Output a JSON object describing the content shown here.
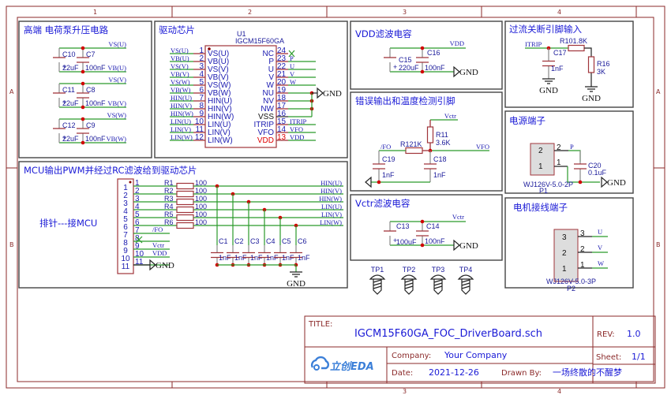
{
  "frame": {
    "columns": [
      "1",
      "2",
      "3",
      "4"
    ],
    "rows": [
      "A",
      "B"
    ]
  },
  "colors": {
    "net": "#2a9a2a",
    "component": "#a0343a",
    "junction": "#d00000",
    "text": "#1a1ad6"
  },
  "high_side": {
    "title": "高端 电荷泵升压电路",
    "groups": [
      {
        "cap_e": "C10",
        "cap_e_value": "22uF",
        "cap": "C7",
        "cap_value": "100nF",
        "net_top": "VS(U)",
        "net_bottom": "VB(U)"
      },
      {
        "cap_e": "C11",
        "cap_e_value": "22uF",
        "cap": "C8",
        "cap_value": "100nF",
        "net_top": "VS(V)",
        "net_bottom": "VB(V)"
      },
      {
        "cap_e": "C12",
        "cap_e_value": "22uF",
        "cap": "C9",
        "cap_value": "100nF",
        "net_top": "VS(W)",
        "net_bottom": "VB(W)"
      }
    ]
  },
  "driver": {
    "title": "驱动芯片",
    "designator": "U1",
    "part": "IGCM15F60GA",
    "left_pins": [
      {
        "num": "1",
        "name": "VS(U)",
        "net": "VS(U)"
      },
      {
        "num": "2",
        "name": "VB(U)",
        "net": "VB(U)"
      },
      {
        "num": "3",
        "name": "VS(V)",
        "net": "VS(V)"
      },
      {
        "num": "4",
        "name": "VB(V)",
        "net": "VB(V)"
      },
      {
        "num": "5",
        "name": "VS(W)",
        "net": "VS(W)"
      },
      {
        "num": "6",
        "name": "VB(W)",
        "net": "VB(W)"
      },
      {
        "num": "7",
        "name": "HIN(U)",
        "net": "HIN(U)"
      },
      {
        "num": "8",
        "name": "HIN(V)",
        "net": "HIN(V)"
      },
      {
        "num": "9",
        "name": "HIN(W)",
        "net": "HIN(W)"
      },
      {
        "num": "10",
        "name": "LIN(U)",
        "net": "LIN(U)"
      },
      {
        "num": "11",
        "name": "LIN(V)",
        "net": "LIN(V)"
      },
      {
        "num": "12",
        "name": "LIN(W)",
        "net": "LIN(W)"
      }
    ],
    "right_pins": [
      {
        "num": "24",
        "name": "NC",
        "net": ""
      },
      {
        "num": "23",
        "name": "P",
        "net": "P"
      },
      {
        "num": "22",
        "name": "U",
        "net": "U"
      },
      {
        "num": "21",
        "name": "V",
        "net": "V"
      },
      {
        "num": "20",
        "name": "W",
        "net": "W"
      },
      {
        "num": "19",
        "name": "NU",
        "net": ""
      },
      {
        "num": "18",
        "name": "NV",
        "net": ""
      },
      {
        "num": "17",
        "name": "NW",
        "net": ""
      },
      {
        "num": "16",
        "name": "VSS",
        "net": ""
      },
      {
        "num": "15",
        "name": "ITRIP",
        "net": "ITRIP"
      },
      {
        "num": "14",
        "name": "VFO",
        "net": "VFO"
      },
      {
        "num": "13",
        "name": "VDD",
        "net": "VDD"
      }
    ],
    "gnd": "GND"
  },
  "mcu": {
    "title": "MCU输出PWM并经过RC滤波给到驱动芯片",
    "header_label": "排针---接MCU",
    "header_pins": [
      "1",
      "2",
      "3",
      "4",
      "5",
      "6",
      "7",
      "8",
      "9",
      "10",
      "11"
    ],
    "channels": [
      {
        "res": "R1",
        "res_value": "100",
        "cap": "C1",
        "cap_value": "1nF",
        "net": "HIN(U)"
      },
      {
        "res": "R2",
        "res_value": "100",
        "cap": "C2",
        "cap_value": "1nF",
        "net": "HIN(V)"
      },
      {
        "res": "R3",
        "res_value": "100",
        "cap": "C3",
        "cap_value": "1nF",
        "net": "HIN(W)"
      },
      {
        "res": "R4",
        "res_value": "100",
        "cap": "C4",
        "cap_value": "1nF",
        "net": "LIN(U)"
      },
      {
        "res": "R5",
        "res_value": "100",
        "cap": "C5",
        "cap_value": "1nF",
        "net": "LIN(V)"
      },
      {
        "res": "R6",
        "res_value": "100",
        "cap": "C6",
        "cap_value": "1nF",
        "net": "LIN(W)"
      }
    ],
    "pin7_net": "/FO",
    "pin9_net": "Vctr",
    "pin10_net": "VDD",
    "pin11_gnd": "GND",
    "cap_gnd": "GND"
  },
  "vdd_filter": {
    "title": "VDD滤波电容",
    "cap_e": "C15",
    "cap_e_value": "220uF",
    "cap": "C16",
    "cap_value": "100nF",
    "net": "VDD",
    "gnd": "GND"
  },
  "fault": {
    "title": "错误输出和温度检测引脚",
    "r_pullup": "R11",
    "r_pullup_value": "3.6K",
    "r_series": "R121K",
    "cap_left": "C19",
    "cap_left_value": "1nF",
    "cap_right": "C18",
    "cap_right_value": "1nF",
    "net_top": "Vctr",
    "net_left": "/FO",
    "net_right": "VFO"
  },
  "vctr_filter": {
    "title": "Vctr滤波电容",
    "cap_e": "C13",
    "cap_e_value": "100uF",
    "cap": "C14",
    "cap_value": "100nF",
    "net": "Vctr",
    "gnd": "GND"
  },
  "test_points": [
    "TP1",
    "TP2",
    "TP3",
    "TP4"
  ],
  "itrip": {
    "title": "过流关断引脚输入",
    "net": "ITRIP",
    "r_series": "R101.8K",
    "r_shunt": "R16",
    "r_shunt_value": "3K",
    "cap": "C17",
    "cap_value": "1nF",
    "gnd": "GND"
  },
  "power": {
    "title": "电源端子",
    "pin2": "2",
    "pin1": "1",
    "pin2_out": "2",
    "pin1_out": "1",
    "net": "P",
    "cap": "C20",
    "cap_value": "0.1uF",
    "gnd": "GND",
    "part": "WJ126V-5.0-2P",
    "designator": "P1"
  },
  "motor": {
    "title": "电机接线端子",
    "pins": [
      {
        "num": "3",
        "net": "U"
      },
      {
        "num": "2",
        "net": "V"
      },
      {
        "num": "1",
        "net": "W"
      }
    ],
    "part": "WJ126V-5.0-3P",
    "designator": "P2"
  },
  "title_block": {
    "title_label": "TITLE:",
    "title": "IGCM15F60GA_FOC_DriverBoard.sch",
    "rev_label": "REV:",
    "rev": "1.0",
    "company_label": "Company:",
    "company": "Your Company",
    "sheet_label": "Sheet:",
    "sheet": "1/1",
    "date_label": "Date:",
    "date": "2021-12-26",
    "drawn_label": "Drawn By:",
    "drawn_by": "一场终散的不醒梦",
    "logo": "立创EDA"
  }
}
